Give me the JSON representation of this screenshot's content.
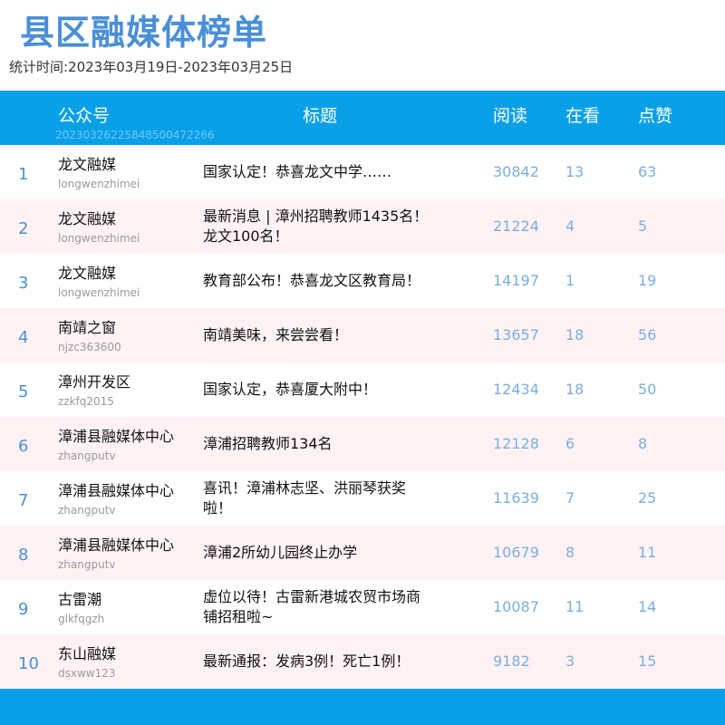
{
  "page": {
    "title": "县区融媒体榜单",
    "period": "统计时间:2023年03月19日-2023年03月25日"
  },
  "header": {
    "account_label": "公众号",
    "title_label": "标题",
    "read_label": "阅读",
    "watch_label": "在看",
    "like_label": "点赞",
    "id_text": "20230326225848500472266"
  },
  "rows": [
    {
      "rank": "1",
      "name": "龙文融媒",
      "account": "longwenzhimei",
      "title": "国家认定！恭喜龙文中学……",
      "read": "30842",
      "watch": "13",
      "like": "63"
    },
    {
      "rank": "2",
      "name": "龙文融媒",
      "account": "longwenzhimei",
      "title": "最新消息 | 漳州招聘教师1435名！龙文100名！",
      "read": "21224",
      "watch": "4",
      "like": "5"
    },
    {
      "rank": "3",
      "name": "龙文融媒",
      "account": "longwenzhimei",
      "title": "教育部公布！恭喜龙文区教育局！",
      "read": "14197",
      "watch": "1",
      "like": "19"
    },
    {
      "rank": "4",
      "name": "南靖之窗",
      "account": "njzc363600",
      "title": "南靖美味，来尝尝看！",
      "read": "13657",
      "watch": "18",
      "like": "56"
    },
    {
      "rank": "5",
      "name": "漳州开发区",
      "account": "zzkfq2015",
      "title": "国家认定，恭喜厦大附中！",
      "read": "12434",
      "watch": "18",
      "like": "50"
    },
    {
      "rank": "6",
      "name": "漳浦县融媒体中心",
      "account": "zhangputv",
      "title": "漳浦招聘教师134名",
      "read": "12128",
      "watch": "6",
      "like": "8"
    },
    {
      "rank": "7",
      "name": "漳浦县融媒体中心",
      "account": "zhangputv",
      "title": "喜讯！漳浦林志坚、洪丽琴获奖啦！",
      "read": "11639",
      "watch": "7",
      "like": "25"
    },
    {
      "rank": "8",
      "name": "漳浦县融媒体中心",
      "account": "zhangputv",
      "title": "漳浦2所幼儿园终止办学",
      "read": "10679",
      "watch": "8",
      "like": "11"
    },
    {
      "rank": "9",
      "name": "古雷潮",
      "account": "glkfqgzh",
      "title": "虚位以待！古雷新港城农贸市场商铺招租啦~",
      "read": "10087",
      "watch": "11",
      "like": "14"
    },
    {
      "rank": "10",
      "name": "东山融媒",
      "account": "dsxww123",
      "title": "最新通报：发病3例！死亡1例！",
      "read": "9182",
      "watch": "3",
      "like": "15"
    }
  ]
}
